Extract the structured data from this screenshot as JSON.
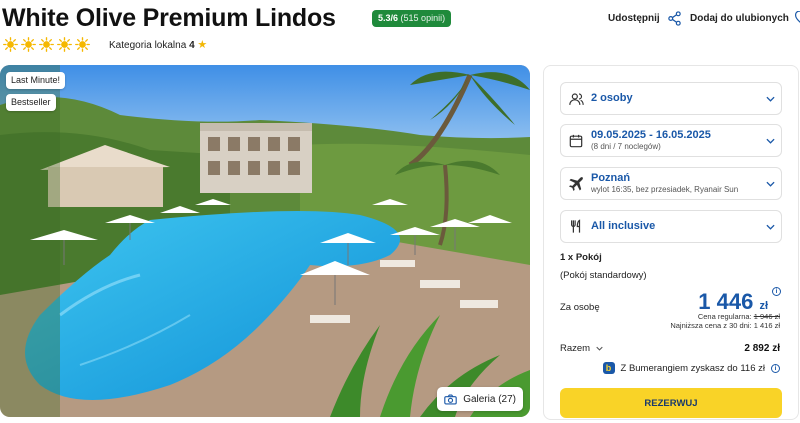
{
  "hotel": {
    "name": "White Olive Premium Lindos",
    "rating_score": "5.3/6",
    "rating_count": "(515 opinii)",
    "suns": 5,
    "category_label": "Kategoria lokalna",
    "category_value": "4"
  },
  "actions": {
    "share_label": "Udostępnij",
    "favorite_label": "Dodaj do ulubionych"
  },
  "photo": {
    "badges": [
      "Last Minute!",
      "Bestseller"
    ],
    "gallery_label": "Galeria (27)"
  },
  "booking": {
    "persons": "2 osoby",
    "dates": "09.05.2025 - 16.05.2025",
    "duration": "(8 dni / 7 noclegów)",
    "departure_city": "Poznań",
    "flight_info": "wylot 16:35, bez przesiadek, Ryanair Sun",
    "board": "All inclusive",
    "room_count": "1 x Pokój",
    "room_type": "(Pokój standardowy)",
    "per_person_label": "Za osobę",
    "price_amount": "1 446",
    "price_currency": "zł",
    "regular_label": "Cena regularna:",
    "regular_price": "1 946 zł",
    "lowest_label": "Najniższa cena z 30 dni:",
    "lowest_price": "1 416 zł",
    "total_label": "Razem",
    "total_price": "2 892 zł",
    "bumerang_text": "Z Bumerangiem zyskasz do 116 zł",
    "reserve_label": "REZERWUJ"
  },
  "colors": {
    "accent_blue": "#1a58a8",
    "rating_green": "#1f8a3b",
    "button_yellow": "#f9d327",
    "sun_yellow": "#f5b800"
  }
}
